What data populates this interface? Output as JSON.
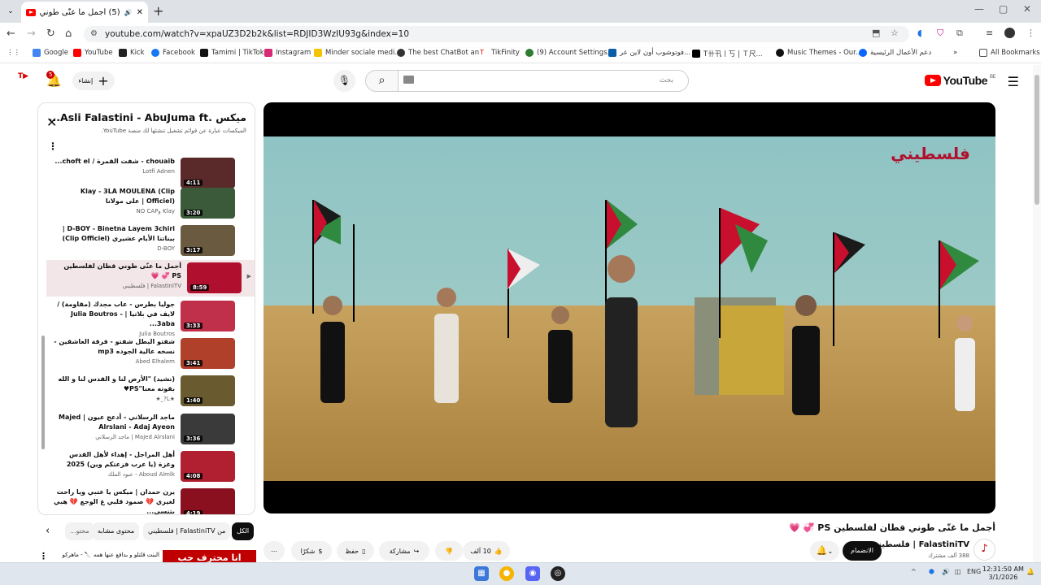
{
  "browser": {
    "tab_title": "(5) أجمل ما عنّى طوني قطان",
    "url": "youtube.com/watch?v=xpaUZ3D2b2k&list=RDJID3WzIU93g&index=10",
    "bookmarks": [
      "Google",
      "YouTube",
      "Kick",
      "Facebook",
      "Tamimi | TikTok",
      "Instagram",
      "Minder sociale medi...",
      "The best ChatBot an...",
      "TikFinity",
      "(9) Account Settings...",
      "فوتوشوب أون لاين عر...",
      "T卄卂丨丂 | Ｔ尺...",
      "Music Themes - Our...",
      "دعم الأعمال الرئيسية",
      "All Bookmarks"
    ]
  },
  "header": {
    "logo_text": "YouTube",
    "logo_region": "BE",
    "search_placeholder": "بحث",
    "create_label": "إنشاء",
    "notification_count": "5"
  },
  "playlist": {
    "title": "ميكس .Asli Falastini - AbuJuma ft...",
    "subtitle": "الميكسات عبارة عن قوائم تشغيل تنشئها لك منصة YouTube.",
    "items": [
      {
        "title": "chouaib - شفت القمرة / choft el...",
        "channel": "Lotfi Adnen",
        "duration": "4:11"
      },
      {
        "title": "Klay - 3LA MOULENA (Clip Officiel) | على مولانا",
        "channel": "Klay وNO CAP",
        "duration": "3:20"
      },
      {
        "title": "D-BOY - Binetna Layem 3chiri | بيناتنا الأيام عشيري (Clip Officiel)",
        "channel": "D-BOY",
        "duration": "3:17"
      },
      {
        "title": "أجمل ما عنّى طوني قطان لفلسطين PS 💞 💗",
        "channel": "FalastiniTV | فلسطيني",
        "duration": "8:59"
      },
      {
        "title": "جوليا بطرس - عاب مجدك (مقاومة) / لايف في بلاتيا | Julia Boutros - 3aba...",
        "channel": "Julia Boutros",
        "duration": "3:33"
      },
      {
        "title": "شفتو البطل شفتو - فرقة العاشقين - نسخه عالية الجوده mp3",
        "channel": "Abed Elhalem",
        "duration": "3:41"
      },
      {
        "title": "(نشيد) \"الأرض لنا و القدس لنا و الله بقوته معنا\"PS♥",
        "channel": "★L?_★",
        "duration": "1:40"
      },
      {
        "title": "ماجد الرسلاني - أدعج عيون | Majed Alrslani - Adaj Ayeon",
        "channel": "Majed Alrslani | ماجد الرسلاني",
        "duration": "3:36"
      },
      {
        "title": "أهل المراجل - إهداء لأهل القدس وغزة (يا عرب فزعتكم وين) 2025",
        "channel": "Aboud Almlk - عبود الملك",
        "duration": "4:08"
      },
      {
        "title": "يزن حمدان | ميكس يا عتبي ويا راحت لغيري 💔 صمود قلبي ع الوجع 💔 هبي بتنسى...",
        "channel": "",
        "duration": "4:19"
      }
    ]
  },
  "chips": [
    "الكل",
    "من FalastiniTV | فلسطيني",
    "محتوى مشابه",
    "محتو..."
  ],
  "below": {
    "title": "البنت قلتلو و بدافع عنها همه 🔪 - ماهركو",
    "thumb_text": "انا محترف حب"
  },
  "video": {
    "title": "أجمل ما غنّى طوني قطان لفلسطين PS 💞 💗",
    "overlay_logo": "فلسطيني",
    "channel_name": "FalastiniTV | فلسطيني",
    "channel_subs": "388 ألف مشترك",
    "join_label": "الانضمام",
    "likes": "10 آلف",
    "share_label": "مشاركة",
    "save_label": "حفظ",
    "thanks_label": "شكرًا"
  },
  "taskbar": {
    "time": "12:31:50 AM",
    "date": "3/1/2026",
    "lang": "ENG"
  }
}
